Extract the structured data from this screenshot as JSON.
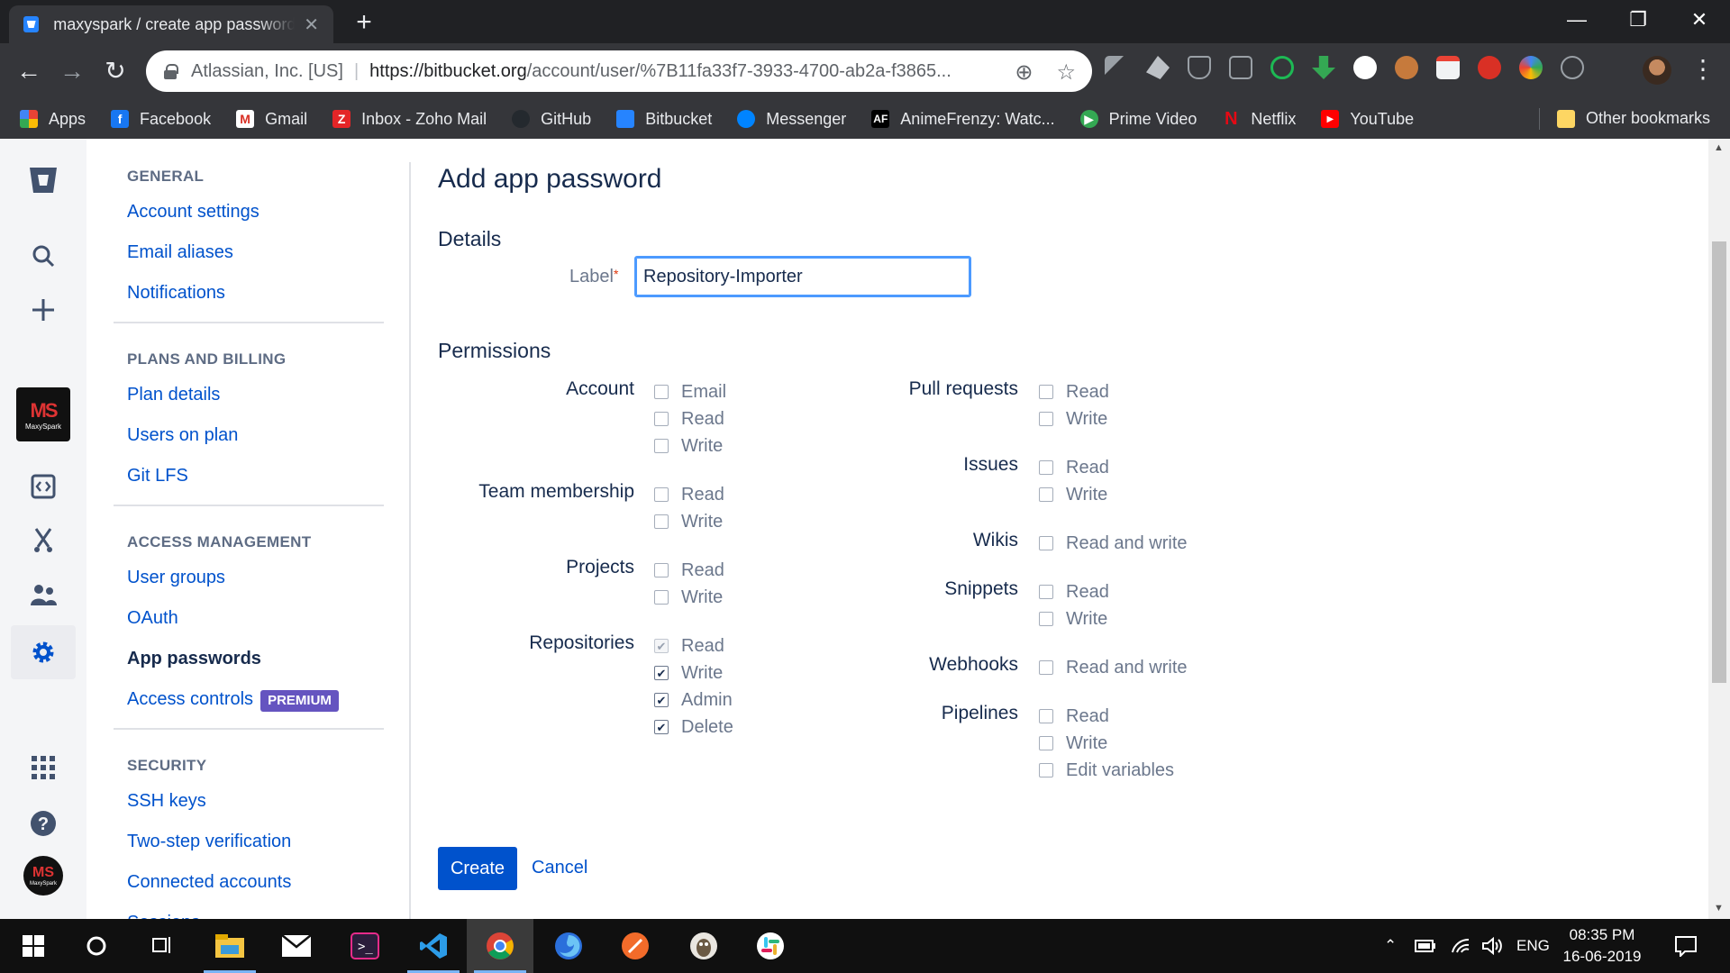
{
  "browser": {
    "tab_title": "maxyspark / create app password",
    "omnibox_org": "Atlassian, Inc. [US]",
    "omnibox_url_host": "https://bitbucket.org",
    "omnibox_url_path": "/account/user/%7B11fa33f7-3933-4700-ab2a-f3865..."
  },
  "bookmarks": [
    {
      "label": "Apps",
      "icon": "apps-grid-icon",
      "color": "#ea4335"
    },
    {
      "label": "Facebook",
      "icon": "facebook-icon",
      "color": "#1877f2"
    },
    {
      "label": "Gmail",
      "icon": "gmail-icon",
      "color": "#d93025"
    },
    {
      "label": "Inbox - Zoho Mail",
      "icon": "zoho-icon",
      "color": "#e42527"
    },
    {
      "label": "GitHub",
      "icon": "github-icon",
      "color": "#24292e"
    },
    {
      "label": "Bitbucket",
      "icon": "bitbucket-icon",
      "color": "#2684ff"
    },
    {
      "label": "Messenger",
      "icon": "messenger-icon",
      "color": "#0084ff"
    },
    {
      "label": "AnimeFrenzy: Watc...",
      "icon": "animefrenzy-icon",
      "color": "#000000"
    },
    {
      "label": "Prime Video",
      "icon": "prime-video-icon",
      "color": "#34a853"
    },
    {
      "label": "Netflix",
      "icon": "netflix-icon",
      "color": "#e50914"
    },
    {
      "label": "YouTube",
      "icon": "youtube-icon",
      "color": "#ff0000"
    }
  ],
  "other_bookmarks": "Other bookmarks",
  "sidebar": {
    "sections": [
      {
        "heading": "GENERAL",
        "items": [
          "Account settings",
          "Email aliases",
          "Notifications"
        ]
      },
      {
        "heading": "PLANS AND BILLING",
        "items": [
          "Plan details",
          "Users on plan",
          "Git LFS"
        ]
      },
      {
        "heading": "ACCESS MANAGEMENT",
        "items": [
          "User groups",
          "OAuth",
          "App passwords",
          "Access controls"
        ]
      },
      {
        "heading": "SECURITY",
        "items": [
          "SSH keys",
          "Two-step verification",
          "Connected accounts",
          "Sessions"
        ]
      }
    ],
    "premium_badge": "PREMIUM",
    "active_item": "App passwords"
  },
  "team_avatar": {
    "mark": "MS",
    "name": "MaxySpark"
  },
  "main": {
    "title": "Add app password",
    "details_heading": "Details",
    "label_field_label": "Label",
    "label_required_marker": "*",
    "label_value": "Repository-Importer",
    "permissions_heading": "Permissions",
    "create_label": "Create",
    "cancel_label": "Cancel"
  },
  "permissions_left": [
    {
      "group": "Account",
      "options": [
        {
          "label": "Email",
          "checked": false
        },
        {
          "label": "Read",
          "checked": false
        },
        {
          "label": "Write",
          "checked": false
        }
      ]
    },
    {
      "group": "Team membership",
      "options": [
        {
          "label": "Read",
          "checked": false
        },
        {
          "label": "Write",
          "checked": false
        }
      ]
    },
    {
      "group": "Projects",
      "options": [
        {
          "label": "Read",
          "checked": false
        },
        {
          "label": "Write",
          "checked": false
        }
      ]
    },
    {
      "group": "Repositories",
      "options": [
        {
          "label": "Read",
          "checked": true,
          "disabled": true
        },
        {
          "label": "Write",
          "checked": true
        },
        {
          "label": "Admin",
          "checked": true
        },
        {
          "label": "Delete",
          "checked": true
        }
      ]
    }
  ],
  "permissions_right": [
    {
      "group": "Pull requests",
      "options": [
        {
          "label": "Read",
          "checked": false
        },
        {
          "label": "Write",
          "checked": false
        }
      ]
    },
    {
      "group": "Issues",
      "options": [
        {
          "label": "Read",
          "checked": false
        },
        {
          "label": "Write",
          "checked": false
        }
      ]
    },
    {
      "group": "Wikis",
      "options": [
        {
          "label": "Read and write",
          "checked": false
        }
      ]
    },
    {
      "group": "Snippets",
      "options": [
        {
          "label": "Read",
          "checked": false
        },
        {
          "label": "Write",
          "checked": false
        }
      ]
    },
    {
      "group": "Webhooks",
      "options": [
        {
          "label": "Read and write",
          "checked": false
        }
      ]
    },
    {
      "group": "Pipelines",
      "options": [
        {
          "label": "Read",
          "checked": false
        },
        {
          "label": "Write",
          "checked": false
        },
        {
          "label": "Edit variables",
          "checked": false
        }
      ]
    }
  ],
  "taskbar": {
    "language": "ENG",
    "time": "08:35 PM",
    "date": "16-06-2019"
  }
}
